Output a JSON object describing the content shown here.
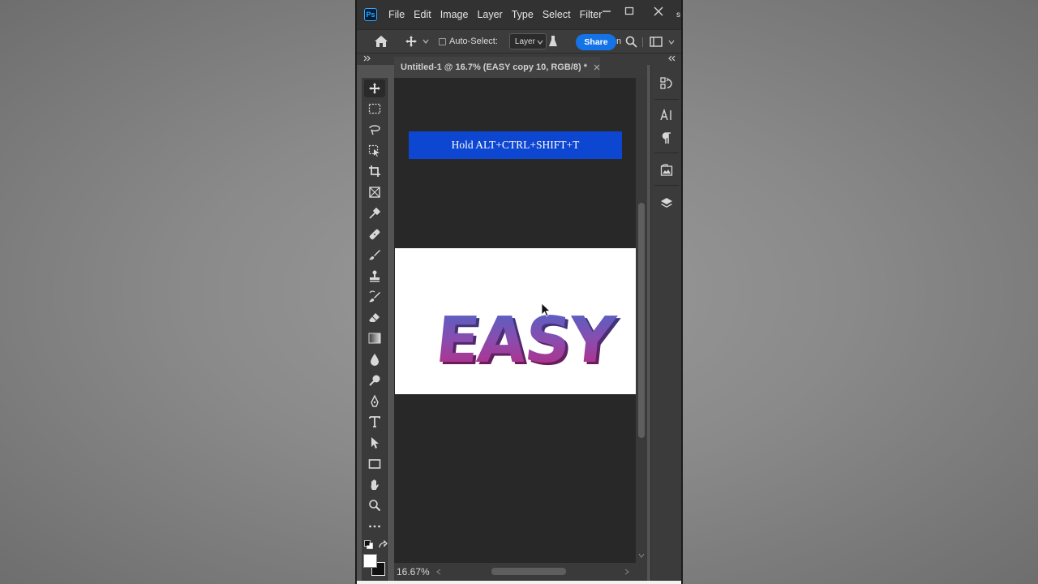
{
  "app": {
    "logo_text": "Ps",
    "menu": [
      "File",
      "Edit",
      "Image",
      "Layer",
      "Type",
      "Select",
      "Filter"
    ],
    "menu_overflow": "s"
  },
  "options_bar": {
    "auto_select_label": "Auto-Select:",
    "auto_select_checked": false,
    "layer_select_value": "Layer",
    "share_label": "Share",
    "partial_text": "n"
  },
  "document": {
    "tab_title": "Untitled-1 @ 16.7% (EASY copy 10, RGB/8) *",
    "banner_text": "Hold ALT+CTRL+SHIFT+T",
    "canvas_text": "EASY"
  },
  "status": {
    "zoom": "16.67%"
  },
  "colors": {
    "share": "#1473e6",
    "banner": "#0d46d1",
    "text_gradient_top": "#4a66c9",
    "text_gradient_bottom": "#c2257c"
  },
  "tools": [
    "move-icon",
    "marquee-icon",
    "lasso-icon",
    "object-select-icon",
    "crop-icon",
    "frame-icon",
    "eyedropper-icon",
    "healing-brush-icon",
    "brush-icon",
    "stamp-icon",
    "history-brush-icon",
    "eraser-icon",
    "gradient-icon",
    "blur-icon",
    "dodge-icon",
    "pen-icon",
    "type-icon",
    "path-select-icon",
    "rectangle-icon",
    "hand-icon",
    "zoom-icon",
    "more-tools-icon"
  ],
  "right_panel": [
    "history-icon",
    "character-icon",
    "paragraph-icon",
    "libraries-icon",
    "layers-icon"
  ]
}
